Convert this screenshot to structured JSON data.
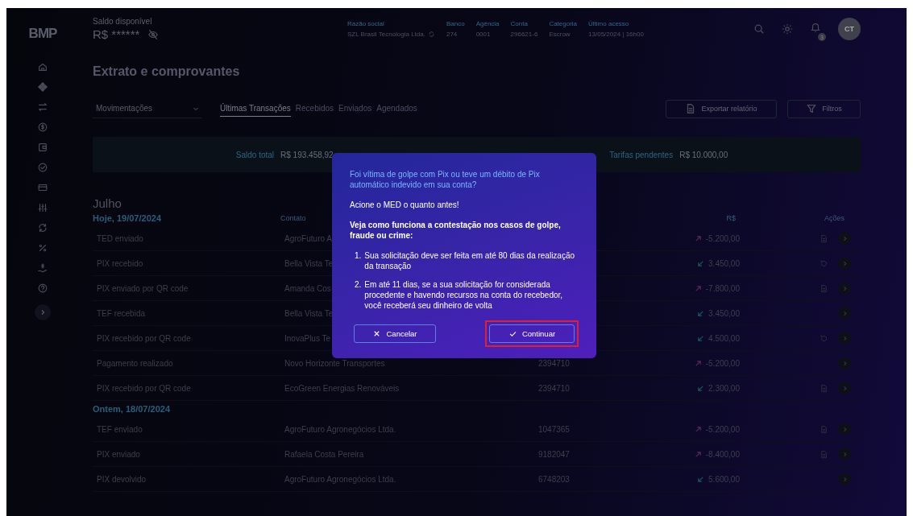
{
  "logo": "BMP",
  "balance": {
    "label": "Saldo disponível",
    "value": "R$ ******",
    "hidden": true
  },
  "account": [
    {
      "label": "Razão social",
      "value": "SZL Brasil Tecnologia Ltda.",
      "switch": true
    },
    {
      "label": "Banco",
      "value": "274",
      "switch": false
    },
    {
      "label": "Agência",
      "value": "0001",
      "switch": false
    },
    {
      "label": "Conta",
      "value": "296621-6",
      "switch": false
    },
    {
      "label": "Categoria",
      "value": "Escrow",
      "switch": false
    },
    {
      "label": "Último acesso",
      "value": "13/05/2024 | 16h00",
      "switch": false
    }
  ],
  "notifications": "3",
  "avatar": "CT",
  "title": "Extrato e comprovantes",
  "dropdown": {
    "value": "Movimentações"
  },
  "tabs": [
    {
      "label": "Últimas Transações",
      "selected": true
    },
    {
      "label": "Recebidos",
      "selected": false
    },
    {
      "label": "Enviados",
      "selected": false
    },
    {
      "label": "Agendados",
      "selected": false
    }
  ],
  "actions": [
    {
      "kind": "export",
      "label": "Exportar relatório"
    },
    {
      "kind": "filter",
      "label": "Filtros"
    }
  ],
  "summary": [
    {
      "label": "Saldo total",
      "value": "R$ 193.458,92"
    },
    {
      "label": "Tarifas pendentes",
      "value": "R$ 10.000,00"
    }
  ],
  "month": "Julho",
  "groups": [
    {
      "date": "Hoje, 19/07/2024",
      "columns": {
        "contact": "Contato",
        "amount": "R$",
        "actions": "Ações"
      },
      "rows": [
        {
          "type": "TED enviado",
          "contact": "AgroFuturo A",
          "outgoing": true,
          "amount": "-5.200,00",
          "kind": "receipt"
        },
        {
          "type": "PIX recebido",
          "contact": "Bella Vista Te",
          "outgoing": false,
          "amount": "3.450,00",
          "kind": "refund"
        },
        {
          "type": "PIX enviado por QR code",
          "contact": "Amanda Cos",
          "outgoing": true,
          "amount": "-7.800,00",
          "kind": "receipt"
        },
        {
          "type": "TEF recebida",
          "contact": "Bella Vista Te",
          "outgoing": false,
          "amount": "3.450,00",
          "kind": "plain"
        },
        {
          "type": "PIX recebido por QR code",
          "contact": "InovaPlus Te",
          "outgoing": false,
          "amount": "4.500,00",
          "kind": "refund"
        },
        {
          "type": "Pagamento realizado",
          "contact": "Novo Horizonte Transportes",
          "number": "2394710",
          "outgoing": true,
          "amount": "-5.200,00",
          "kind": "plain"
        },
        {
          "type": "PIX recebido por QR code",
          "contact": "EcoGreen Energias Renováveis",
          "number": "2394710",
          "outgoing": false,
          "amount": "2.300,00",
          "kind": "receipt"
        }
      ]
    },
    {
      "date": "Ontem, 18/07/2024",
      "rows": [
        {
          "type": "TEF enviado",
          "contact": "AgroFuturo Agronegócios Ltda.",
          "number": "1047365",
          "outgoing": true,
          "amount": "-5.200,00",
          "kind": "receipt"
        },
        {
          "type": "PIX enviado",
          "contact": "Rafaela Costa Pereira",
          "number": "9182047",
          "outgoing": true,
          "amount": "-8.400,00",
          "kind": "receipt"
        },
        {
          "type": "PIX devolvido",
          "contact": "AgroFuturo Agronegócios Ltda.",
          "number": "6748203",
          "outgoing": false,
          "amount": "5.600,00",
          "kind": "plain"
        }
      ]
    }
  ],
  "dialog": {
    "heading": "Foi vítima de golpe com Pix ou teve um débito de Pix automático indevido em sua conta?",
    "lead": "Acione o MED o quanto antes!",
    "intro": "Veja como funciona a contestação nos casos de  golpe, fraude ou crime:",
    "steps": [
      {
        "number": "1.",
        "text": "Sua solicitação deve ser feita em até 80 dias da realização da transação"
      },
      {
        "number": "2.",
        "text": "Em até 11 dias, se a sua solicitação for  considerada procedente e havendo recursos na conta do recebedor, você receberá seu dinheiro  de volta"
      }
    ],
    "buttons": [
      {
        "kind": "cancel",
        "label": "Cancelar",
        "highlighted": false
      },
      {
        "kind": "confirm",
        "label": "Continuar",
        "highlighted": true
      }
    ]
  }
}
